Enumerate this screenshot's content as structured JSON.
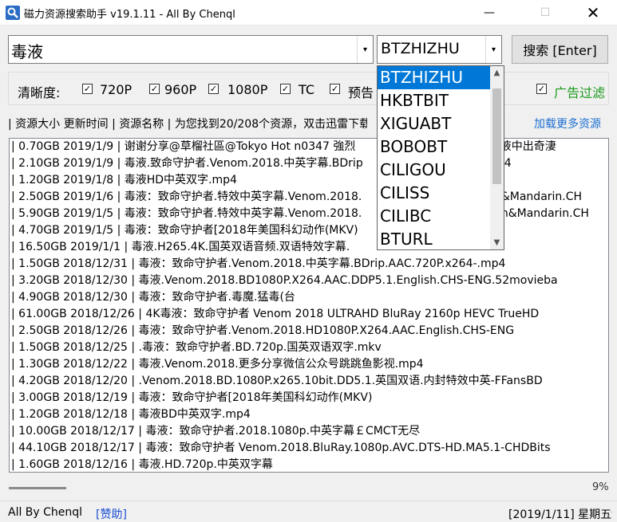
{
  "window": {
    "title": "磁力资源搜索助手 v19.1.11 - All By Chenql",
    "min_glyph": "—",
    "max_glyph": "☐",
    "close_glyph": "✕"
  },
  "search": {
    "query_value": "毒液",
    "site_selected": "BTZHIZHU",
    "dropdown_arrow": "▾",
    "button_label": "搜索 [Enter]"
  },
  "filters": {
    "label": "清晰度:",
    "check_glyph": "✓",
    "options": [
      {
        "label": "720P",
        "checked": true
      },
      {
        "label": "960P",
        "checked": true
      },
      {
        "label": "1080P",
        "checked": true
      },
      {
        "label": "TC",
        "checked": true
      },
      {
        "label": "预告",
        "checked": true
      }
    ],
    "ad_filter": {
      "label": "广告过滤",
      "checked": true,
      "color": "#1a9a1a"
    }
  },
  "status": {
    "text": "| 资源大小 更新时间 | 资源名称 | 为您找到20/208个资源，双击迅雷下载",
    "load_more": "加载更多资源",
    "link_color": "#1b6fd1"
  },
  "results": [
    "| 0.70GB 2019/1/9 | 谢谢分享@草榴社區@Tokyo Hot n0347 強烈ㅤㅤㅤㅤㅤㅤㅤㅤㅤㅤㅤㅤㅤ毒液中出奇淒",
    "| 2.10GB 2019/1/9 | 毒液.致命守护者.Venom.2018.中英字幕.BDripㅤㅤㅤㅤㅤㅤㅤㅤㅤㅤㅤㅤmp4",
    "| 1.20GB 2019/1/8 | 毒液HD中英双字.mp4",
    "| 2.50GB 2019/1/6 | 毒液：致命守护者.特效中英字幕.Venom.2018.ㅤㅤㅤㅤㅤㅤㅤㅤㅤㅤㅤglish&Mandarin.CH",
    "| 5.90GB 2019/1/5 | 毒液：致命守护者.特效中英字幕.Venom.2018.ㅤㅤㅤㅤㅤㅤㅤㅤㅤㅤㅤnglish&Mandarin.CH",
    "| 4.70GB 2019/1/5 | 毒液：致命守护者[2018年美国科幻动作(MKV)",
    "| 16.50GB 2019/1/1 | 毒液.H265.4K.国英双语音频.双语特效字幕.",
    "| 1.50GB 2018/12/31 | 毒液：致命守护者.Venom.2018.中英字幕.BDrip.AAC.720P.x264-.mp4",
    "| 3.20GB 2018/12/30 | 毒液.Venom.2018.BD1080P.X264.AAC.DDP5.1.English.CHS-ENG.52movieba",
    "| 4.90GB 2018/12/30 | 毒液：致命守护者.毒魔.猛毒(台",
    "| 61.00GB 2018/12/26 | 4K毒液：致命守护者 Venom 2018 ULTRAHD BluRay 2160p HEVC TrueHD",
    "| 2.50GB 2018/12/26 | 毒液：致命守护者.Venom.2018.HD1080P.X264.AAC.English.CHS-ENG",
    "| 1.50GB 2018/12/25 | .毒液：致命守护者.BD.720p.国英双语双字.mkv",
    "| 1.30GB 2018/12/22 | 毒液.Venom.2018.更多分享微信公众号跳跳鱼影视.mp4",
    "| 4.20GB 2018/12/20 | .Venom.2018.BD.1080P.x265.10bit.DD5.1.英国双语.内封特效中英-FFansBD",
    "| 3.00GB 2018/12/19 | 毒液：致命守护者[2018年美国科幻动作(MKV)",
    "| 1.20GB 2018/12/18 | 毒液BD中英双字.mp4",
    "| 10.00GB 2018/12/17 | 毒液：致命守护者.2018.1080p.中英字幕￡CMCT无尽",
    "| 44.10GB 2018/12/17 | 毒液：致命守护者 Venom.2018.BluRay.1080p.AVC.DTS-HD.MA5.1-CHDBits",
    "| 1.60GB 2018/12/16 | 毒液.HD.720p.中英双字幕"
  ],
  "progress": {
    "text": "9%"
  },
  "statusbar": {
    "author": "All By Chenql",
    "donate": "[赞助]",
    "date": "[2019/1/11] 星期五"
  },
  "dropdown": {
    "items": [
      "BTZHIZHU",
      "HKBTBIT",
      "XIGUABT",
      "BOBOBT",
      "CILIGOU",
      "CILISS",
      "CILIBC",
      "BTURL"
    ],
    "selected_index": 0,
    "accent": "#0078d7",
    "scroll_up": "▲",
    "scroll_down": "▼"
  }
}
